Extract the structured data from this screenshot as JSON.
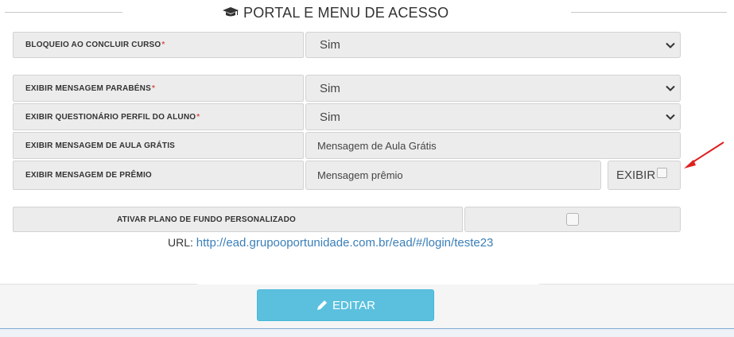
{
  "section": {
    "title": "PORTAL E MENU DE ACESSO",
    "icon": "graduation-cap-icon"
  },
  "fields": [
    {
      "label": "BLOQUEIO AO CONCLUIR CURSO",
      "required": "*",
      "value": "Sim"
    },
    {
      "label": "EXIBIR MENSAGEM PARABÉNS",
      "required": "*",
      "value": "Sim"
    },
    {
      "label": "EXIBIR QUESTIONÁRIO PERFIL DO ALUNO",
      "required": "*",
      "value": "Sim"
    },
    {
      "label": "EXIBIR MENSAGEM DE AULA GRÁTIS",
      "value": "Mensagem de Aula Grátis"
    },
    {
      "label": "EXIBIR MENSAGEM DE PRÊMIO",
      "value": "Mensagem prêmio",
      "checkbox_label": "EXIBIR"
    },
    {
      "label": "ATIVAR PLANO DE FUNDO PERSONALIZADO"
    }
  ],
  "url": {
    "prefix": "URL:",
    "link": "http://ead.grupooportunidade.com.br/ead/#/login/teste23"
  },
  "actions": {
    "edit_label": "EDITAR",
    "edit_icon": "pencil-icon"
  },
  "colors": {
    "accent": "#5bc0de",
    "required": "#d9534f",
    "link": "#3a7fb8",
    "annotation_arrow": "#e02020"
  }
}
